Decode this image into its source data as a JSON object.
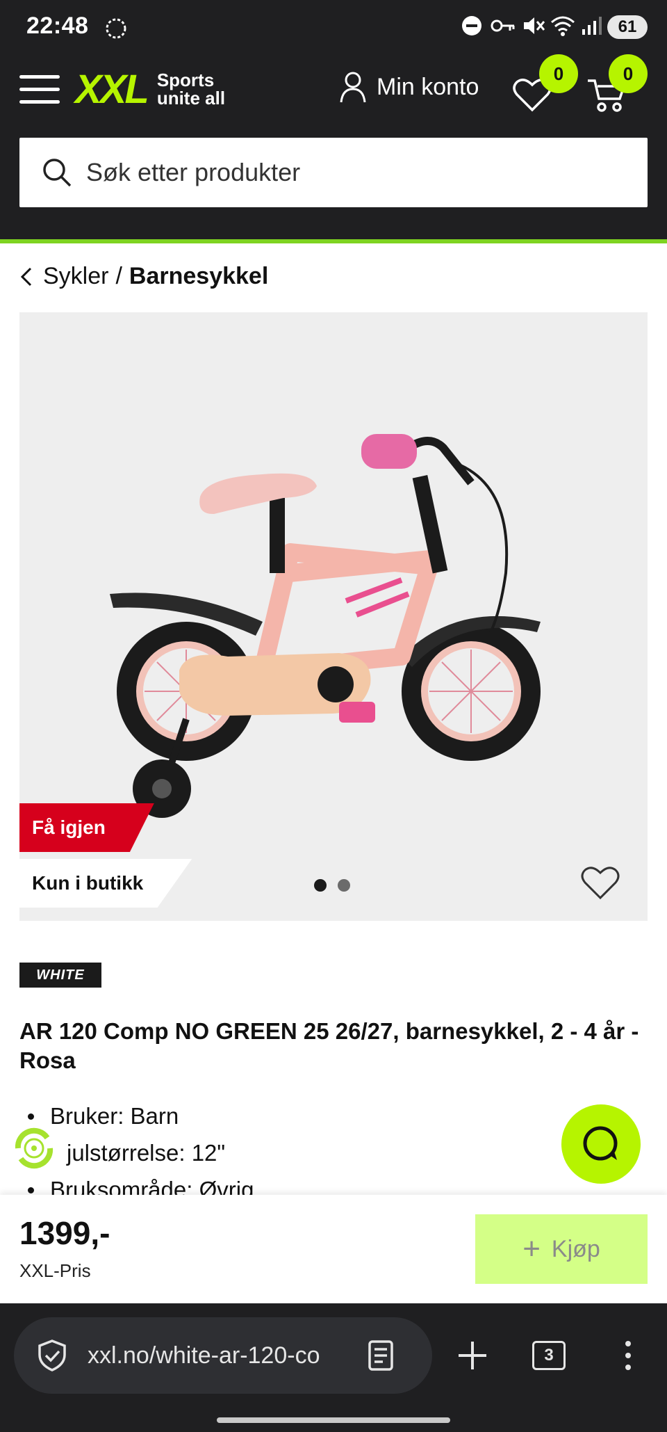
{
  "status_bar": {
    "time": "22:48",
    "battery": "61"
  },
  "header": {
    "logo_text": "XXL",
    "logo_tagline_1": "Sports",
    "logo_tagline_2": "unite all",
    "account_label": "Min konto",
    "wishlist_count": "0",
    "cart_count": "0",
    "search_placeholder": "Søk etter produkter"
  },
  "breadcrumb": {
    "parent": "Sykler",
    "separator": "/",
    "current": "Barnesykkel"
  },
  "gallery": {
    "badge_primary": "Få igjen",
    "badge_secondary": "Kun i butikk",
    "page_count": 2,
    "active_page": 1
  },
  "product": {
    "brand": "WHITE",
    "title": "AR 120 Comp NO GREEN 25 26/27, barnesykkel, 2 - 4 år - Rosa",
    "specs": [
      "Bruker: Barn",
      "julstørrelse: 12\"",
      "Bruksområde: Øvrig"
    ]
  },
  "buy_bar": {
    "price": "1399,-",
    "price_label": "XXL-Pris",
    "buy_label": "Kjøp"
  },
  "browser": {
    "url": "xxl.no/white-ar-120-co",
    "tab_count": "3"
  },
  "colors": {
    "accent": "#b6f400",
    "header_bg": "#1f1f21",
    "sale_red": "#d6001c",
    "buy_disabled": "#d4ff87"
  }
}
